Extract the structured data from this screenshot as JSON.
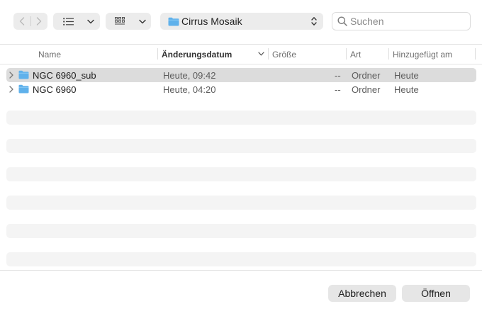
{
  "toolbar": {
    "back_icon": "chevron-left-icon",
    "forward_icon": "chevron-right-icon",
    "view_icon": "list-view-icon",
    "group_icon": "grid-group-icon",
    "path": {
      "folder": "Cirrus Mosaik"
    },
    "search": {
      "placeholder": "Suchen",
      "value": ""
    }
  },
  "columns": {
    "name": "Name",
    "date": "Änderungsdatum",
    "size": "Größe",
    "kind": "Art",
    "added": "Hinzugefügt am",
    "sorted_by": "date",
    "sort_icon": "chevron-down-icon"
  },
  "files": [
    {
      "name": "NGC 6960_sub",
      "date": "Heute, 09:42",
      "size": "--",
      "kind": "Ordner",
      "added": "Heute",
      "selected": true
    },
    {
      "name": "NGC 6960",
      "date": "Heute, 04:20",
      "size": "--",
      "kind": "Ordner",
      "added": "Heute",
      "selected": false
    }
  ],
  "footer": {
    "cancel_label": "Abbrechen",
    "open_label": "Öffnen"
  },
  "colors": {
    "folder": "#5fb1eb",
    "selection": "#dcdcdc",
    "stripe": "#f4f4f4",
    "button": "#e6e6e6"
  }
}
